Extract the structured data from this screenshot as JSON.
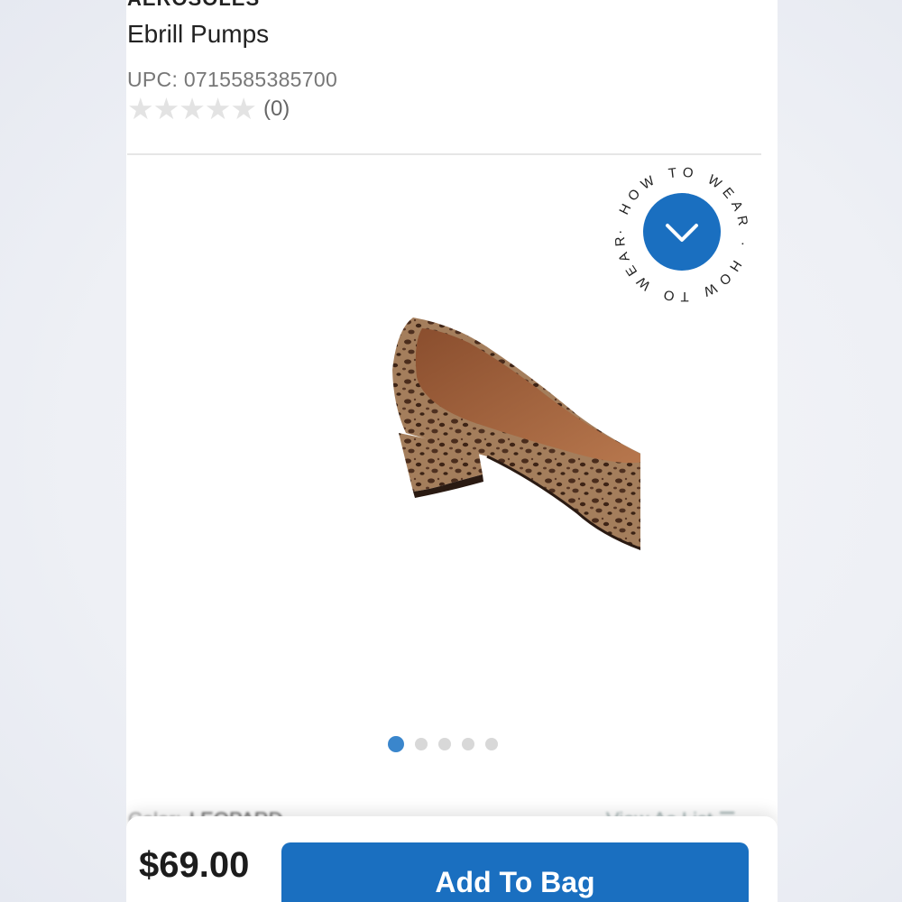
{
  "product": {
    "brand": "AEROSOLES",
    "name": "Ebrill Pumps",
    "upc": "UPC: 0715585385700",
    "rating": 0,
    "review_count": "(0)",
    "image_name": "leopard-pump-shoe"
  },
  "how_to_wear": {
    "label": "· HOW TO WEAR · HOW TO WEAR",
    "icon": "chevron-down-icon",
    "accent": "#1a6fc0"
  },
  "carousel": {
    "total": 5,
    "active_index": 0,
    "active_color": "#3a86cc",
    "inactive_color": "#d8d8d8"
  },
  "color_row": {
    "label": "Color:",
    "value": "LEOPARD",
    "view_as_list": "View As List"
  },
  "purchase": {
    "price": "$69.00",
    "add_to_bag": "Add To Bag",
    "button_color": "#1a6fc0"
  }
}
